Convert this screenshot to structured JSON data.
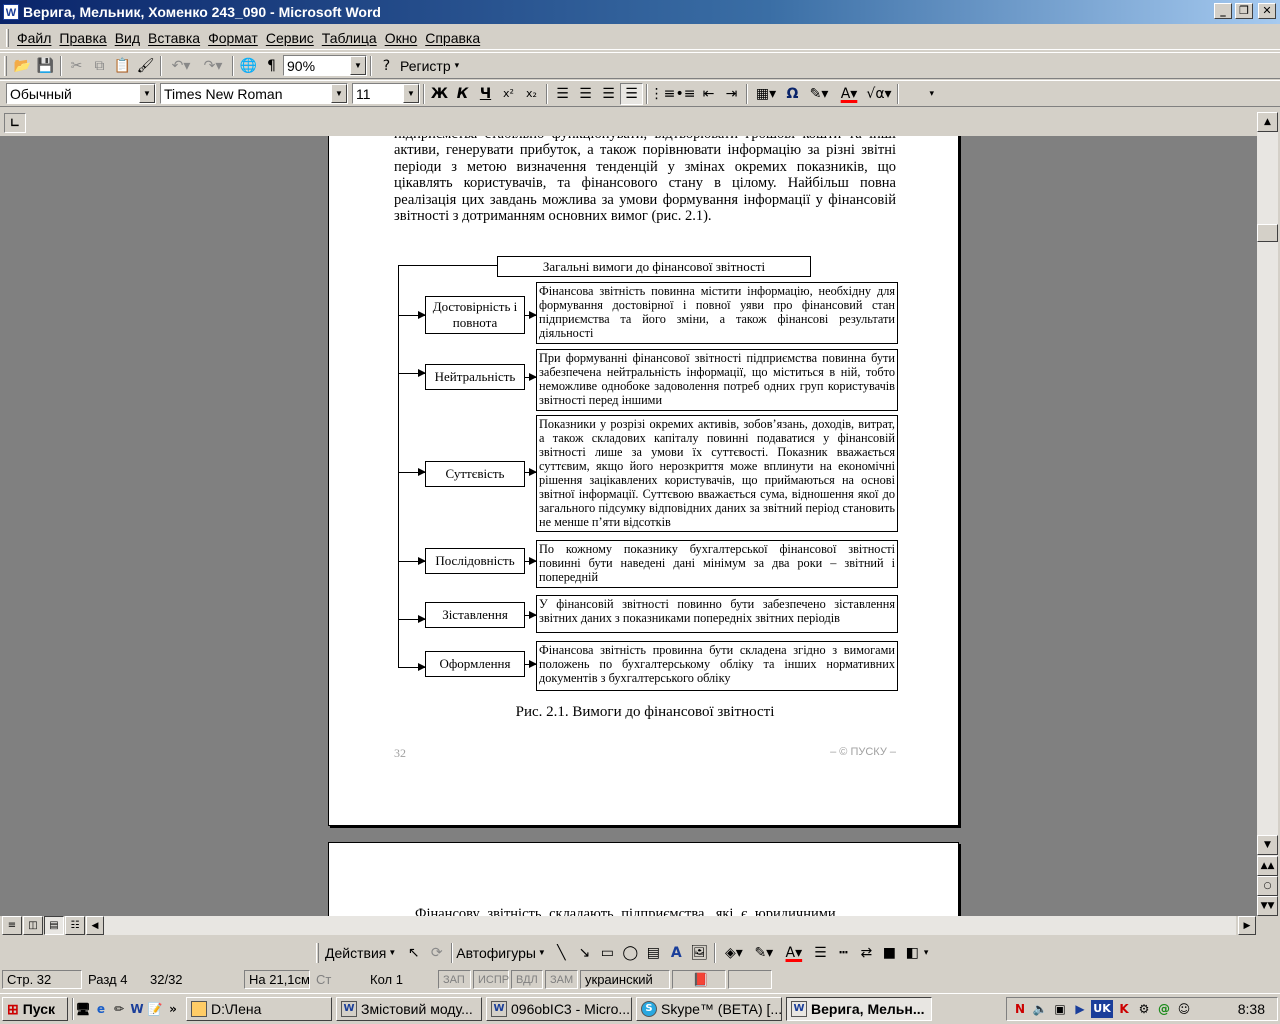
{
  "window": {
    "title": "Верига, Мельник, Хоменко 243_090 - Microsoft Word",
    "app_icon": "W"
  },
  "menu": [
    "Файл",
    "Правка",
    "Вид",
    "Вставка",
    "Формат",
    "Сервис",
    "Таблица",
    "Окно",
    "Справка"
  ],
  "standard_toolbar": {
    "zoom": "90%",
    "register_label": "Регистр"
  },
  "format_toolbar": {
    "style": "Обычный",
    "font": "Times New Roman",
    "size": "11",
    "bold": "Ж",
    "italic": "К",
    "underline": "Ч"
  },
  "document": {
    "intro": "підприємства стабільно функціонувати, відтворювати грошові кошти та інші активи, генерувати прибуток, а також порівнювати інформацію за різні звітні періоди з метою визначення тенденцій у змінах окремих показників, що цікавлять користувачів, та фінансового стану в цілому. Найбільш повна реалізація цих завдань можлива за умови формування інформації у фінансовій звітності з дотриманням основних вимог (рис. 2.1).",
    "diagram_title": "Загальні вимоги до фінансової звітності",
    "requirements": [
      {
        "name": "Достовірність і повнота",
        "text": "Фінансова звітність повинна містити інформацію, необхідну для формування достовірної і повної уяви про фінансовий стан підприємства та його зміни, а також фінансові результати діяльності"
      },
      {
        "name": "Нейтральність",
        "text": "При формуванні фінансової звітності підприємства повинна бути забезпечена нейтральність інформації, що міститься в ній, тобто неможливе однобоке задоволення потреб одних груп користувачів звітності перед іншими"
      },
      {
        "name": "Суттєвість",
        "text": "Показники у розрізі окремих активів, зобов’язань, доходів, витрат, а також складових капіталу повинні подаватися у фінансовій звітності лише за умови їх суттєвості. Показник вважається суттєвим, якщо його нерозкриття може вплинути на економічні рішення зацікавлених користувачів, що приймаються на основі звітної інформації. Суттєвою вважається сума, відношення якої до загального підсумку відповідних даних за звітний період становить не менше п’яти відсотків"
      },
      {
        "name": "Послідовність",
        "text": "По кожному показнику бухгалтерської фінансової звітності повинні бути наведені дані мінімум за два роки – звітний і попередній"
      },
      {
        "name": "Зіставлення",
        "text": "У фінансовій звітності повинно бути забезпечено зіставлення звітних даних з показниками попередніх звітних періодів"
      },
      {
        "name": "Оформлення",
        "text": "Фінансова звітність провинна бути складена згідно з вимогами положень по бухгалтерському обліку та інших нормативних документів з бухгалтерського обліку"
      }
    ],
    "caption": "Рис. 2.1. Вимоги до фінансової звітності",
    "page_number": "32",
    "footer_right": "– © ПУСКУ –",
    "next_page_text": "Фінансову звітність складають підприємства, які є юридичними"
  },
  "drawing_toolbar": {
    "actions": "Действия",
    "autoshapes": "Автофигуры"
  },
  "status": {
    "page": "Стр. 32",
    "section": "Разд 4",
    "pages": "32/32",
    "at": "На 21,1см",
    "line": "Ст",
    "col": "Кол 1",
    "rec": "ЗАП",
    "trk": "ИСПР",
    "ext": "ВДЛ",
    "ovr": "ЗАМ",
    "language": "украинский"
  },
  "taskbar": {
    "start": "Пуск",
    "tasks": [
      "D:\\Лена",
      "Змістовий моду...",
      "096оbІС3 - Micro...",
      "Skype™ (BETA) [...",
      "Верига, Мельн..."
    ],
    "clock": "8:38",
    "lang": "UK"
  }
}
